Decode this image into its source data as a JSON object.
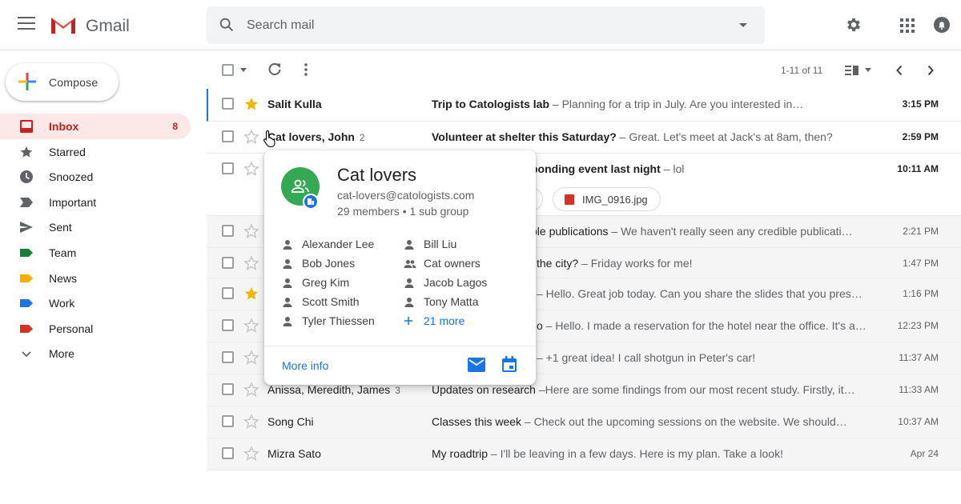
{
  "app": {
    "brand": "Gmail"
  },
  "search": {
    "placeholder": "Search mail"
  },
  "compose": {
    "label": "Compose"
  },
  "nav": [
    {
      "label": "Inbox",
      "count": "8",
      "icon": "inbox-icon",
      "active": true
    },
    {
      "label": "Starred",
      "count": "",
      "icon": "star-icon"
    },
    {
      "label": "Snoozed",
      "count": "",
      "icon": "clock-icon"
    },
    {
      "label": "Important",
      "count": "",
      "icon": "important-icon"
    },
    {
      "label": "Sent",
      "count": "",
      "icon": "send-icon"
    },
    {
      "label": "Team",
      "count": "",
      "icon": "label-icon",
      "color": "#188038"
    },
    {
      "label": "News",
      "count": "",
      "icon": "label-icon",
      "color": "#f9ab00"
    },
    {
      "label": "Work",
      "count": "",
      "icon": "label-icon",
      "color": "#1a73e8"
    },
    {
      "label": "Personal",
      "count": "",
      "icon": "label-icon",
      "color": "#d93025"
    },
    {
      "label": "More",
      "count": "",
      "icon": "chevron-down-icon"
    }
  ],
  "toolbar": {
    "pager": "1-11 of 11"
  },
  "emails": [
    {
      "sender": "Salit Kulla",
      "count": "",
      "subject": "Trip to Catologists lab",
      "snippet": " – Planning for a trip in July. Are you interested in…",
      "time": "3:15 PM",
      "unread": true,
      "starred": true
    },
    {
      "sender": "Cat lovers, John",
      "count": "2",
      "subject": "Volunteer at shelter this Saturday?",
      "snippet": " – Great. Let's meet at Jack's at 8am, then?",
      "time": "2:59 PM",
      "unread": true,
      "starred": false
    },
    {
      "sender": "",
      "count": "",
      "subject": "bonding event last night",
      "snippet": " – lol",
      "time": "10:11 AM",
      "unread": true,
      "starred": false,
      "attachment": "IMG_0916.jpg"
    },
    {
      "sender": "",
      "count": "",
      "subject": "ble publications",
      "snippet": " – We haven't really seen any credible publicati…",
      "time": "2:21 PM",
      "unread": false,
      "starred": false
    },
    {
      "sender": "",
      "count": "",
      "subject": "the city?",
      "snippet": " – Friday works for me!",
      "time": "1:47 PM",
      "unread": false,
      "starred": false
    },
    {
      "sender": "",
      "count": "",
      "subject": "",
      "snippet": " – Hello. Great job today. Can you share the slides that you pres…",
      "time": "1:16 PM",
      "unread": false,
      "starred": true
    },
    {
      "sender": "",
      "count": "",
      "subject": "o",
      "snippet": " – Hello. I made a reservation for the hotel near the office. It's a…",
      "time": "12:23 PM",
      "unread": false,
      "starred": false
    },
    {
      "sender": "",
      "count": "",
      "subject": "",
      "snippet": " – +1 great idea! I call shotgun in Peter's car!",
      "time": "11:37 AM",
      "unread": false,
      "starred": false
    },
    {
      "sender": "Anissa, Meredith, James",
      "count": "3",
      "subject": "Updates on research",
      "snippet": " –Here are some findings from our most recent study. Firstly, it…",
      "time": "11:33 AM",
      "unread": false,
      "starred": false
    },
    {
      "sender": "Song Chi",
      "count": "",
      "subject": "Classes this week",
      "snippet": " – Check out the upcoming sessions on the website. We should…",
      "time": "10:37 AM",
      "unread": false,
      "starred": false
    },
    {
      "sender": "Mizra Sato",
      "count": "",
      "subject": "My roadtrip",
      "snippet": " – I'll be leaving in a few days. Here is my plan. Take a look!",
      "time": "Apr 24",
      "unread": false,
      "starred": false
    }
  ],
  "card": {
    "title": "Cat lovers",
    "email": "cat-lovers@catologists.com",
    "meta": "29 members • 1 sub group",
    "members_left": [
      "Alexander Lee",
      "Bob Jones",
      "Greg Kim",
      "Scott Smith",
      "Tyler Thiessen"
    ],
    "members_right": [
      "Bill Liu",
      "Cat owners",
      "Jacob Lagos",
      "Tony Matta",
      "21 more"
    ],
    "more_info": "More info"
  }
}
